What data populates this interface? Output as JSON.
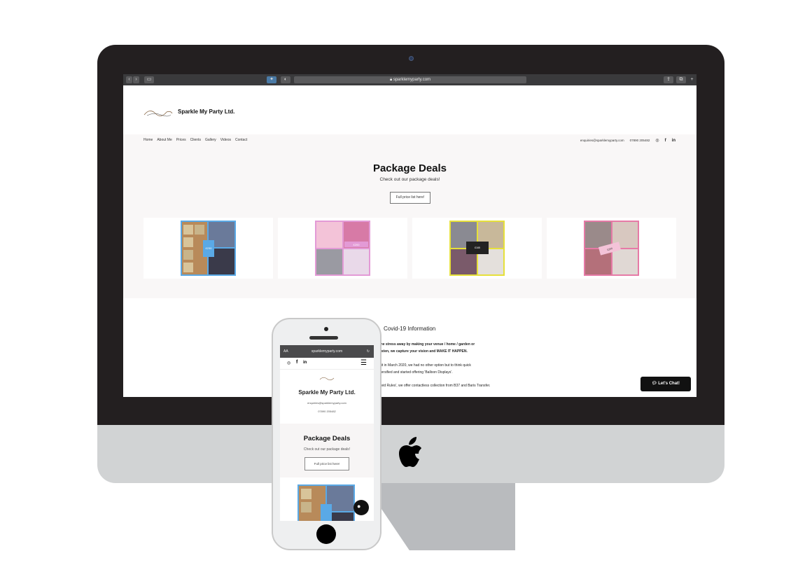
{
  "browser": {
    "url": "sparklemyparty.com"
  },
  "site": {
    "name": "Sparkle My Party Ltd.",
    "nav": [
      "Home",
      "About Me",
      "Prices",
      "Clients",
      "Gallery",
      "Videos",
      "Contact"
    ],
    "email": "enquiries@sparklemyparty.com",
    "phone": "07890 205482",
    "social_icons": [
      "instagram-icon",
      "facebook-icon",
      "linkedin-icon"
    ]
  },
  "package_deals": {
    "title": "Package Deals",
    "subtitle": "Check out our package deals!",
    "button": "Full price list here!",
    "cards": [
      {
        "badge": "£230 PACKAGE DEAL",
        "accent": "#5aa9e6"
      },
      {
        "badge": "£200 PACKAGE DEAL",
        "accent": "#e39ad6"
      },
      {
        "badge": "PARTY ROOM PACKAGE £165",
        "accent": "#e6e03a"
      },
      {
        "badge": "£200 PACKAGE DEAL",
        "accent": "#e67aa6"
      }
    ]
  },
  "covid": {
    "title": "Covid-19 Information",
    "lines": [
      "the stress away by making your venue / home / garden or",
      "listen, we capture your vision and MAKE IT HAPPEN.",
      "hit in March 2020, we had no other option but to think quick",
      "versified and started offering 'Balloon Displays'.",
      "avid Rules', we offer contactless collection from B37 and Baris Transfer."
    ]
  },
  "chat": {
    "label": "Let's Chat!"
  },
  "mobile": {
    "aa": "AA",
    "url": "sparklemyparty.com",
    "site_name": "Sparkle My Party Ltd.",
    "email": "enquiries@sparklemyparty.com",
    "phone": "07890 205482",
    "pd_title": "Package Deals",
    "pd_subtitle": "Check out our package deals!",
    "pd_button": "Full price list here!"
  }
}
